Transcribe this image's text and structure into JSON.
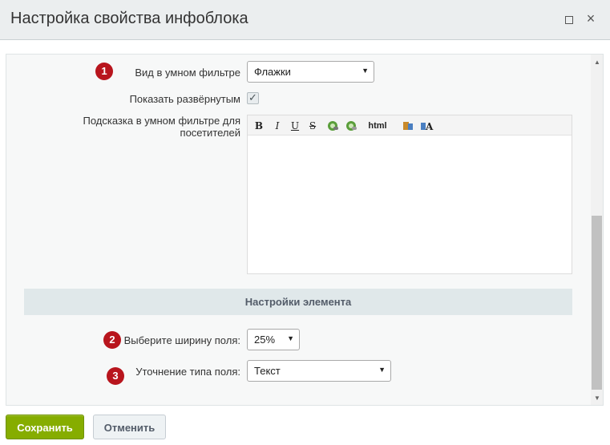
{
  "dialog": {
    "title": "Настройка свойства инфоблока",
    "maximize_icon": "maximize-icon",
    "close_icon": "close-icon",
    "close_glyph": "×"
  },
  "fields": {
    "smart_filter_view": {
      "badge": "1",
      "label": "Вид в умном фильтре",
      "value": "Флажки"
    },
    "show_expanded": {
      "label": "Показать развёрнутым",
      "checked": true
    },
    "smart_filter_hint": {
      "label": "Подсказка в умном фильтре для посетителей",
      "value": ""
    },
    "field_width": {
      "badge": "2",
      "label": "Выберите ширину поля:",
      "value": "25%"
    },
    "field_type": {
      "badge": "3",
      "label": "Уточнение типа поля:",
      "value": "Текст"
    }
  },
  "editor_toolbar": {
    "bold": "B",
    "italic": "I",
    "underline": "U",
    "strike": "S",
    "insert_link_icon": "link-icon",
    "remove_link_icon": "unlink-icon",
    "html": "html",
    "clean_format_icon": "clean-format-icon",
    "font_color_icon": "font-color-icon"
  },
  "section": {
    "element_settings": "Настройки элемента"
  },
  "footer": {
    "save": "Сохранить",
    "cancel": "Отменить"
  },
  "colors": {
    "badge": "#b8151d",
    "save_button": "#86ad00",
    "section_header": "#e0e8ea",
    "titlebar": "#ebeeef"
  }
}
